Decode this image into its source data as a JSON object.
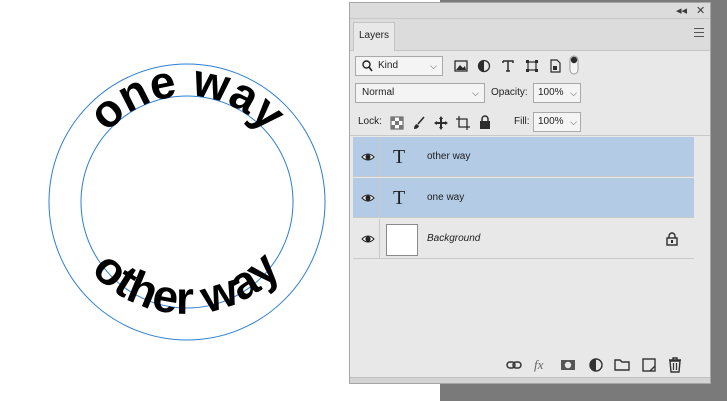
{
  "canvas": {
    "arc_top_text": "one way",
    "arc_bottom_text": "other way",
    "guide_color": "#2d7fd3"
  },
  "panel": {
    "collapse_label": "◂◂",
    "close_label": "✕",
    "tab_label": "Layers",
    "filter": {
      "kind_label": "Kind",
      "icons": [
        "image-filter-icon",
        "adjustment-filter-icon",
        "type-filter-icon",
        "shape-filter-icon",
        "smart-object-filter-icon",
        "filter-toggle-icon"
      ]
    },
    "blend_mode": "Normal",
    "opacity_label": "Opacity:",
    "opacity_value": "100%",
    "lock_label": "Lock:",
    "fill_label": "Fill:",
    "fill_value": "100%",
    "layers": [
      {
        "name": "other way",
        "type": "text",
        "selected": true,
        "thumb_glyph": "T"
      },
      {
        "name": "one way",
        "type": "text",
        "selected": true,
        "thumb_glyph": "T"
      },
      {
        "name": "Background",
        "type": "background",
        "selected": false,
        "locked": true
      }
    ],
    "bottom_icons": [
      "link-layers-icon",
      "fx-icon",
      "mask-icon",
      "adjustment-layer-icon",
      "group-folder-icon",
      "new-layer-icon",
      "delete-layer-icon"
    ],
    "fx_label": "fx",
    "selection_color": "#b4cbe6"
  }
}
